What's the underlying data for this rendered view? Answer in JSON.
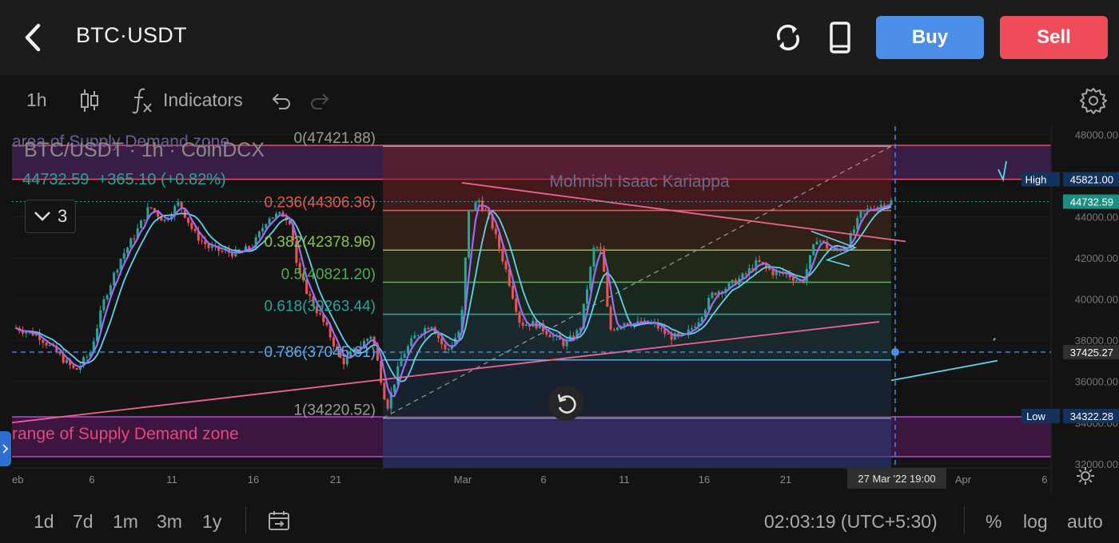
{
  "header": {
    "title": "BTC·USDT",
    "buy_label": "Buy",
    "sell_label": "Sell"
  },
  "toolbar": {
    "interval": "1h",
    "indicators_label": "Indicators"
  },
  "legend": {
    "symbol_line": "BTC/USDT · 1h · CoinDCX",
    "last": "44732.59",
    "change": "+365.10",
    "change_pct": "(+0.82%)",
    "collapse_count": "3"
  },
  "bottom": {
    "ranges": [
      "1d",
      "7d",
      "1m",
      "3m",
      "1y"
    ],
    "clock": "02:03:19 (UTC+5:30)",
    "pct": "%",
    "log": "log",
    "auto": "auto"
  },
  "colors": {
    "bg": "#131313",
    "up": "#26a69a",
    "down": "#ef5350",
    "ma_fast": "#9b6cf5",
    "ma_slow": "#5fd3e8",
    "buy": "#4b8fe8",
    "sell": "#ee4b5b"
  },
  "chart_data": {
    "type": "candlestick",
    "symbol": "BTC/USDT",
    "interval": "1h",
    "exchange": "CoinDCX",
    "watermark": "Mohnish Isaac Kariappa",
    "ylim": [
      31800,
      48400
    ],
    "y_ticks": [
      32000,
      34000,
      36000,
      38000,
      40000,
      42000,
      44000,
      46000,
      48000
    ],
    "y_tick_labels": [
      "32000.00",
      "34000.00",
      "36000.00",
      "38000.00",
      "40000.00",
      "42000.00",
      "44000.00",
      "46000.00",
      "48000.00"
    ],
    "x_tick_labels": [
      "eb",
      "6",
      "11",
      "16",
      "21",
      "Mar",
      "6",
      "11",
      "16",
      "21",
      "Apr",
      "6"
    ],
    "price_path": [
      [
        0,
        38600
      ],
      [
        1.5,
        38250
      ],
      [
        3,
        37200
      ],
      [
        4,
        36500
      ],
      [
        5,
        37400
      ],
      [
        6,
        40100
      ],
      [
        7,
        41900
      ],
      [
        8,
        43100
      ],
      [
        9,
        44500
      ],
      [
        10,
        43800
      ],
      [
        11,
        44700
      ],
      [
        12,
        43200
      ],
      [
        13,
        42500
      ],
      [
        14,
        42300
      ],
      [
        15,
        42200
      ],
      [
        16,
        42600
      ],
      [
        17,
        44000
      ],
      [
        18,
        44100
      ],
      [
        18.5,
        43800
      ],
      [
        19,
        41300
      ],
      [
        20,
        39800
      ],
      [
        21,
        38500
      ],
      [
        22,
        36900
      ],
      [
        23,
        37600
      ],
      [
        24,
        38300
      ],
      [
        25,
        34700
      ],
      [
        26,
        37200
      ],
      [
        27,
        38300
      ],
      [
        28,
        38800
      ],
      [
        29,
        37400
      ],
      [
        30,
        38600
      ],
      [
        30.5,
        44200
      ],
      [
        31.2,
        44800
      ],
      [
        32,
        43800
      ],
      [
        33,
        41500
      ],
      [
        34,
        38800
      ],
      [
        35,
        38800
      ],
      [
        36,
        38300
      ],
      [
        37,
        37800
      ],
      [
        38,
        38500
      ],
      [
        39,
        42600
      ],
      [
        39.5,
        42300
      ],
      [
        40,
        38500
      ],
      [
        41,
        38900
      ],
      [
        42,
        38800
      ],
      [
        43,
        38800
      ],
      [
        44,
        38200
      ],
      [
        45,
        38100
      ],
      [
        46,
        39000
      ],
      [
        47,
        40300
      ],
      [
        48,
        40600
      ],
      [
        49,
        41100
      ],
      [
        50,
        41800
      ],
      [
        51,
        41300
      ],
      [
        52,
        41200
      ],
      [
        53,
        40800
      ],
      [
        54,
        43000
      ],
      [
        55,
        42300
      ],
      [
        56,
        42600
      ],
      [
        57,
        44200
      ],
      [
        58,
        44500
      ],
      [
        59,
        44730
      ]
    ],
    "fib_levels": [
      {
        "ratio": 0,
        "price": 47421.88,
        "label": "0(47421.88)"
      },
      {
        "ratio": 0.236,
        "price": 44306.36,
        "label": "0.236(44306.36)"
      },
      {
        "ratio": 0.382,
        "price": 42378.96,
        "label": "0.382(42378.96)"
      },
      {
        "ratio": 0.5,
        "price": 40821.2,
        "label": "0.5(40821.20)"
      },
      {
        "ratio": 0.618,
        "price": 39263.44,
        "label": "0.618(39263.44)"
      },
      {
        "ratio": 0.786,
        "price": 37045.61,
        "label": "0.786(37045.61)"
      },
      {
        "ratio": 1,
        "price": 34220.52,
        "label": "1(34220.52)"
      }
    ],
    "zones": [
      {
        "label": "area of Supply Demand zone",
        "from": 45821,
        "to": 47470
      },
      {
        "label": "range of Supply Demand zone",
        "from": 32350,
        "to": 34280
      }
    ],
    "price_labels": [
      {
        "name": "High",
        "value": "45821.00"
      },
      {
        "name": "Last",
        "value": "44732.59"
      },
      {
        "name": "Cursor",
        "value": "37425.27"
      },
      {
        "name": "Low",
        "value": "34322.28"
      }
    ],
    "crosshair": {
      "price": 37425.27,
      "time_label": "27 Mar '22   19:00"
    }
  }
}
